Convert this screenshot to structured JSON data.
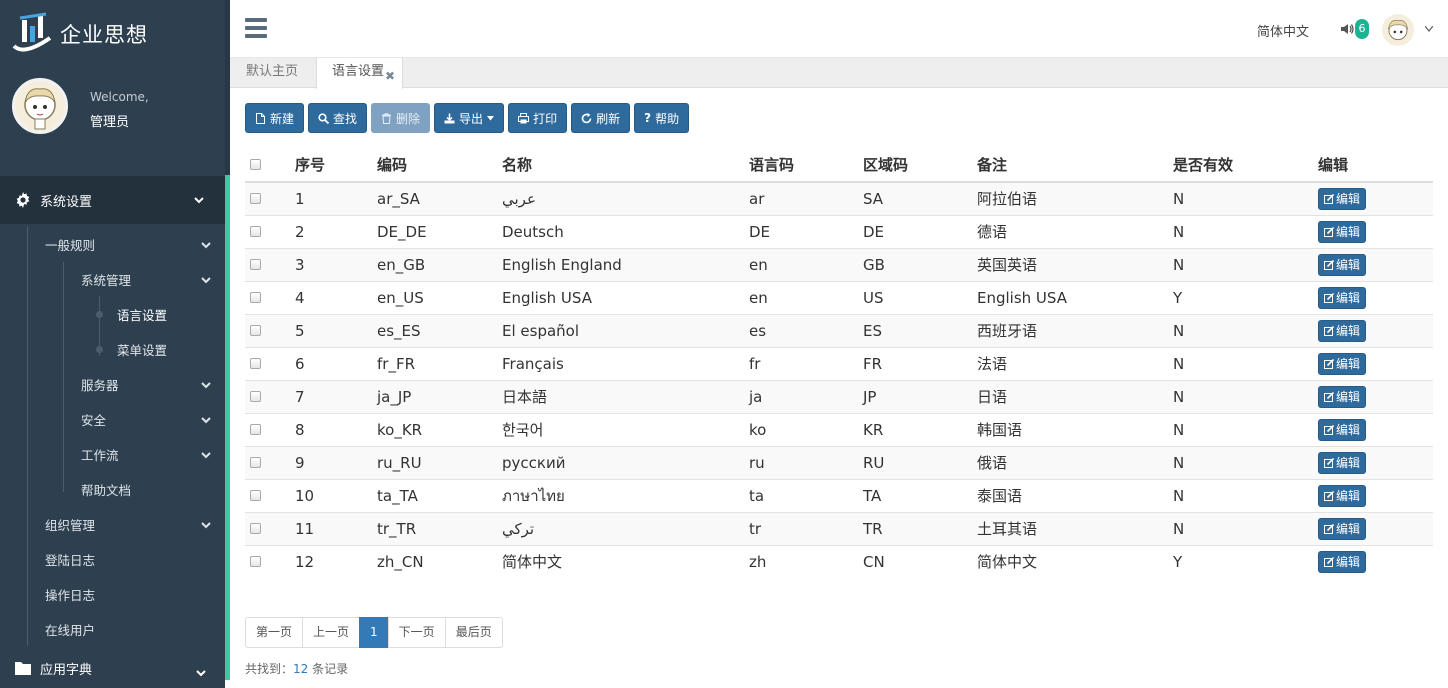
{
  "brand": {
    "name": "企业思想"
  },
  "profile": {
    "welcome": "Welcome,",
    "name": "管理员"
  },
  "sidebar": {
    "system_settings": "系统设置",
    "general_rules": "一般规则",
    "system_management": "系统管理",
    "language_settings": "语言设置",
    "menu_settings": "菜单设置",
    "server": "服务器",
    "security": "安全",
    "workflow": "工作流",
    "help_docs": "帮助文档",
    "org_management": "组织管理",
    "login_log": "登陆日志",
    "operation_log": "操作日志",
    "online_users": "在线用户",
    "app_dictionary": "应用字典"
  },
  "header": {
    "language": "简体中文",
    "notification_count": "6"
  },
  "tabs": [
    {
      "label": "默认主页"
    },
    {
      "label": "语言设置"
    }
  ],
  "toolbar": {
    "new": "新建",
    "search": "查找",
    "delete": "删除",
    "export": "导出",
    "print": "打印",
    "refresh": "刷新",
    "help": "帮助"
  },
  "table": {
    "headers": [
      "序号",
      "编码",
      "名称",
      "语言码",
      "区域码",
      "备注",
      "是否有效",
      "编辑"
    ],
    "edit_label": "编辑",
    "rows": [
      {
        "no": "1",
        "code": "ar_SA",
        "name": "عربي",
        "lang": "ar",
        "region": "SA",
        "remark": "阿拉伯语",
        "valid": "N"
      },
      {
        "no": "2",
        "code": "DE_DE",
        "name": "Deutsch",
        "lang": "DE",
        "region": "DE",
        "remark": "德语",
        "valid": "N"
      },
      {
        "no": "3",
        "code": "en_GB",
        "name": "English England",
        "lang": "en",
        "region": "GB",
        "remark": "英国英语",
        "valid": "N"
      },
      {
        "no": "4",
        "code": "en_US",
        "name": "English USA",
        "lang": "en",
        "region": "US",
        "remark": "English USA",
        "valid": "Y"
      },
      {
        "no": "5",
        "code": "es_ES",
        "name": "El español",
        "lang": "es",
        "region": "ES",
        "remark": "西班牙语",
        "valid": "N"
      },
      {
        "no": "6",
        "code": "fr_FR",
        "name": "Français",
        "lang": "fr",
        "region": "FR",
        "remark": "法语",
        "valid": "N"
      },
      {
        "no": "7",
        "code": "ja_JP",
        "name": "日本語",
        "lang": "ja",
        "region": "JP",
        "remark": "日语",
        "valid": "N"
      },
      {
        "no": "8",
        "code": "ko_KR",
        "name": "한국어",
        "lang": "ko",
        "region": "KR",
        "remark": "韩国语",
        "valid": "N"
      },
      {
        "no": "9",
        "code": "ru_RU",
        "name": "русский",
        "lang": "ru",
        "region": "RU",
        "remark": "俄语",
        "valid": "N"
      },
      {
        "no": "10",
        "code": "ta_TA",
        "name": "ภาษาไทย",
        "lang": "ta",
        "region": "TA",
        "remark": "泰国语",
        "valid": "N"
      },
      {
        "no": "11",
        "code": "tr_TR",
        "name": "تركي",
        "lang": "tr",
        "region": "TR",
        "remark": "土耳其语",
        "valid": "N"
      },
      {
        "no": "12",
        "code": "zh_CN",
        "name": "简体中文",
        "lang": "zh",
        "region": "CN",
        "remark": "简体中文",
        "valid": "Y"
      }
    ]
  },
  "pagination": {
    "first": "第一页",
    "prev": "上一页",
    "current": "1",
    "next": "下一页",
    "last": "最后页"
  },
  "summary": {
    "prefix": "共找到：",
    "count": "12",
    "suffix": "条记录"
  },
  "colors": {
    "sidebar_bg": "#2e4050",
    "accent": "#3fc8a1",
    "primary_button": "#2f6a9d",
    "badge": "#1ab394"
  }
}
